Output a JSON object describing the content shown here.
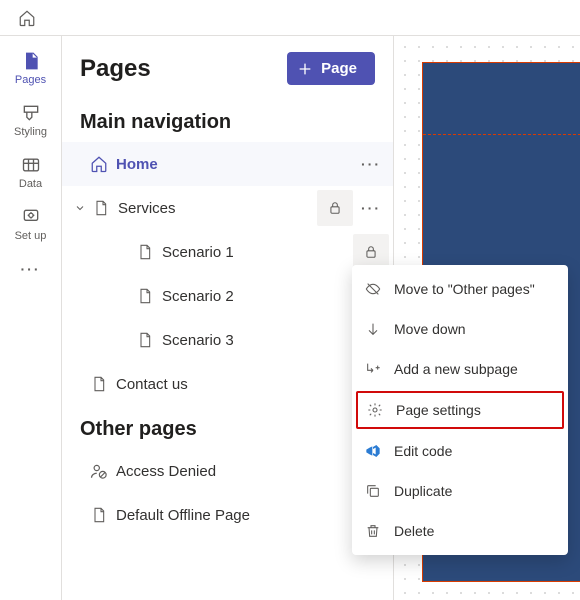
{
  "rail": {
    "items": [
      {
        "label": "Pages",
        "active": true
      },
      {
        "label": "Styling"
      },
      {
        "label": "Data"
      },
      {
        "label": "Set up"
      }
    ]
  },
  "panel": {
    "title": "Pages",
    "add_button_label": "Page",
    "sections": {
      "main": {
        "title": "Main navigation",
        "items": [
          {
            "label": "Home"
          },
          {
            "label": "Services"
          },
          {
            "label": "Scenario 1"
          },
          {
            "label": "Scenario 2"
          },
          {
            "label": "Scenario 3"
          },
          {
            "label": "Contact us"
          }
        ]
      },
      "other": {
        "title": "Other pages",
        "items": [
          {
            "label": "Access Denied"
          },
          {
            "label": "Default Offline Page"
          }
        ]
      }
    }
  },
  "context_menu": {
    "items": [
      {
        "label": "Move to \"Other pages\""
      },
      {
        "label": "Move down"
      },
      {
        "label": "Add a new subpage"
      },
      {
        "label": "Page settings"
      },
      {
        "label": "Edit code"
      },
      {
        "label": "Duplicate"
      },
      {
        "label": "Delete"
      }
    ]
  }
}
